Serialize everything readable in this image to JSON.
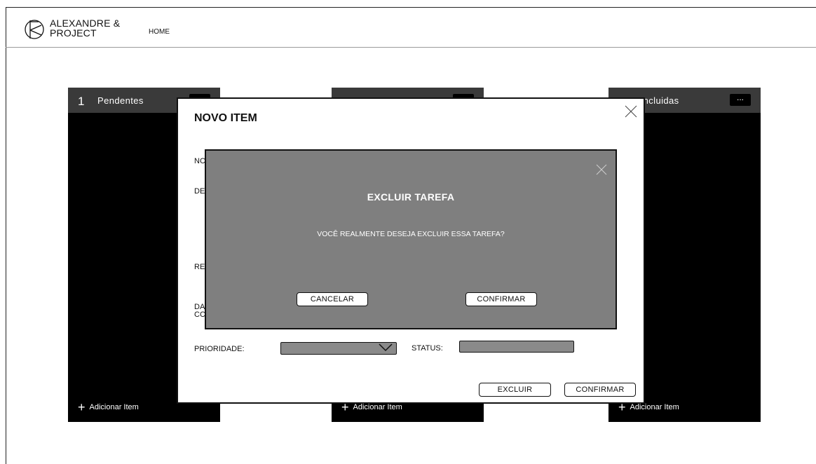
{
  "header": {
    "brand_line1": "ALEXANDRE &",
    "brand_line2": "PROJECT",
    "nav_home": "HOME"
  },
  "columns": [
    {
      "count": "1",
      "title": "Pendentes",
      "add_label": "Adicionar Item"
    },
    {
      "count": "",
      "title": "",
      "add_label": "Adicionar Item"
    },
    {
      "count": "",
      "title": "oncluidas",
      "add_label": "Adicionar Item"
    }
  ],
  "column_menu_label": "...",
  "modal": {
    "title": "NOVO ITEM",
    "partial_labels": [
      "NC",
      "DE",
      "RE",
      "DA",
      "CC"
    ],
    "priority_label": "PRIORIDADE:",
    "status_label": "STATUS:",
    "delete_button": "EXCLUIR",
    "confirm_button": "CONFIRMAR"
  },
  "dialog": {
    "title": "EXCLUIR TAREFA",
    "message": "VOCÊ REALMENTE DESEJA EXCLUIR ESSA TAREFA?",
    "cancel_button": "CANCELAR",
    "confirm_button": "CONFIRMAR"
  },
  "colors": {
    "column_bg": "#000000",
    "column_header_bg": "#3a3a3a",
    "dialog_bg": "#7f7f7f",
    "input_bg": "#8a8a8a"
  }
}
